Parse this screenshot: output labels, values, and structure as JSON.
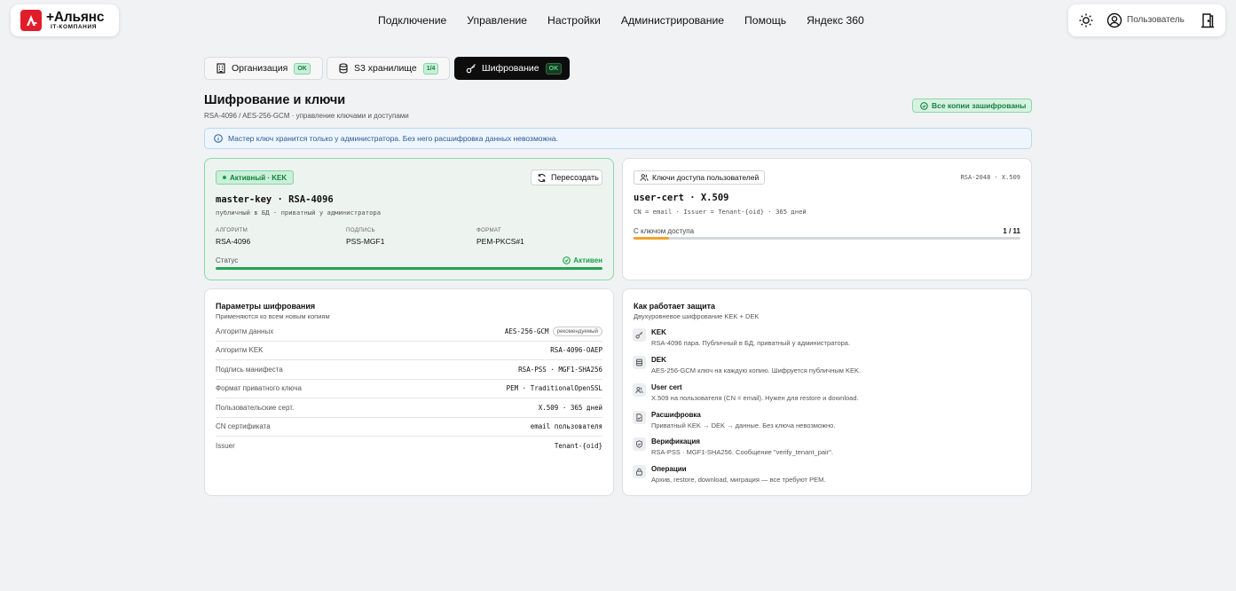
{
  "brand": {
    "name": "+Альянс",
    "tagline": "IT-КОМПАНИЯ"
  },
  "nav": [
    "Подключение",
    "Управление",
    "Настройки",
    "Администрирование",
    "Помощь",
    "Яндекс 360"
  ],
  "user": {
    "label": "Пользователь"
  },
  "tabs": [
    {
      "label": "Организация",
      "badge": "OK",
      "icon": "building-icon"
    },
    {
      "label": "S3 хранилище",
      "badge": "1/4",
      "icon": "database-icon"
    },
    {
      "label": "Шифрование",
      "badge": "OK",
      "icon": "key-icon"
    }
  ],
  "page": {
    "title": "Шифрование и ключи",
    "subtitle": "RSA-4096 / AES-256-GCM · управление ключами и доступами",
    "status": "Все копии зашифрованы",
    "info": "Мастер ключ хранится только у администратора. Без него расшифровка данных невозможна."
  },
  "kek": {
    "badge": "Активный · KEK",
    "rotate": "Пересоздать",
    "title": "master-key · RSA-4096",
    "subtitle": "публичный в БД · приватный у администратора",
    "fields": [
      {
        "k": "АЛГОРИТМ",
        "v": "RSA-4096"
      },
      {
        "k": "ПОДПИСЬ",
        "v": "PSS-MGF1"
      },
      {
        "k": "ФОРМАТ",
        "v": "PEM-PKCS#1"
      }
    ],
    "status_label": "Статус",
    "status_value": "Активен",
    "status_fill": 1.0
  },
  "user_cert": {
    "button": "Ключи доступа пользователей",
    "algo": "RSA-2048 · X.509",
    "title": "user-cert · X.509",
    "subtitle": "CN = email · Issuer = Tenant-{oid} · 365 дней",
    "progress_label": "С ключом доступа",
    "progress_value": "1 / 11",
    "progress_fraction": 0.0909
  },
  "params": {
    "title": "Параметры шифрования",
    "subtitle": "Применяются ко всем новым копиям",
    "recommended": "рекомендуемый",
    "rows": [
      {
        "label": "Алгоритм данных",
        "value": "AES-256-GCM"
      },
      {
        "label": "Алгоритм KEK",
        "value": "RSA-4096-OAEP"
      },
      {
        "label": "Подпись манифеста",
        "value": "RSA-PSS · MGF1-SHA256"
      },
      {
        "label": "Формат приватного ключа",
        "value": "PEM · TraditionalOpenSSL"
      },
      {
        "label": "Пользовательские серт.",
        "value": "X.509 · 365 дней"
      },
      {
        "label": "CN сертификата",
        "value": "email пользователя"
      },
      {
        "label": "Issuer",
        "value": "Tenant-{oid}"
      }
    ]
  },
  "how": {
    "title": "Как работает защита",
    "subtitle": "Двухуровневое шифрование KEK + DEK",
    "items": [
      {
        "title": "KEK",
        "desc": "RSA-4096 пара. Публичный в БД, приватный у администратора.",
        "icon": "key-icon"
      },
      {
        "title": "DEK",
        "desc": "AES-256-GCM ключ на каждую копию. Шифруется публичным KEK.",
        "icon": "database-icon"
      },
      {
        "title": "User cert",
        "desc": "X.509 на пользователя (CN = email). Нужен для restore и download.",
        "icon": "users-icon"
      },
      {
        "title": "Расшифровка",
        "desc": "Приватный KEK → DEK → данные. Без ключа невозможно.",
        "icon": "file-check-icon"
      },
      {
        "title": "Верификация",
        "desc": "RSA-PSS · MGF1-SHA256. Сообщение \"verify_tenant_pair\".",
        "icon": "shield-check-icon"
      },
      {
        "title": "Операции",
        "desc": "Архив, restore, download, миграция — все требуют PEM.",
        "icon": "lock-icon"
      }
    ]
  }
}
